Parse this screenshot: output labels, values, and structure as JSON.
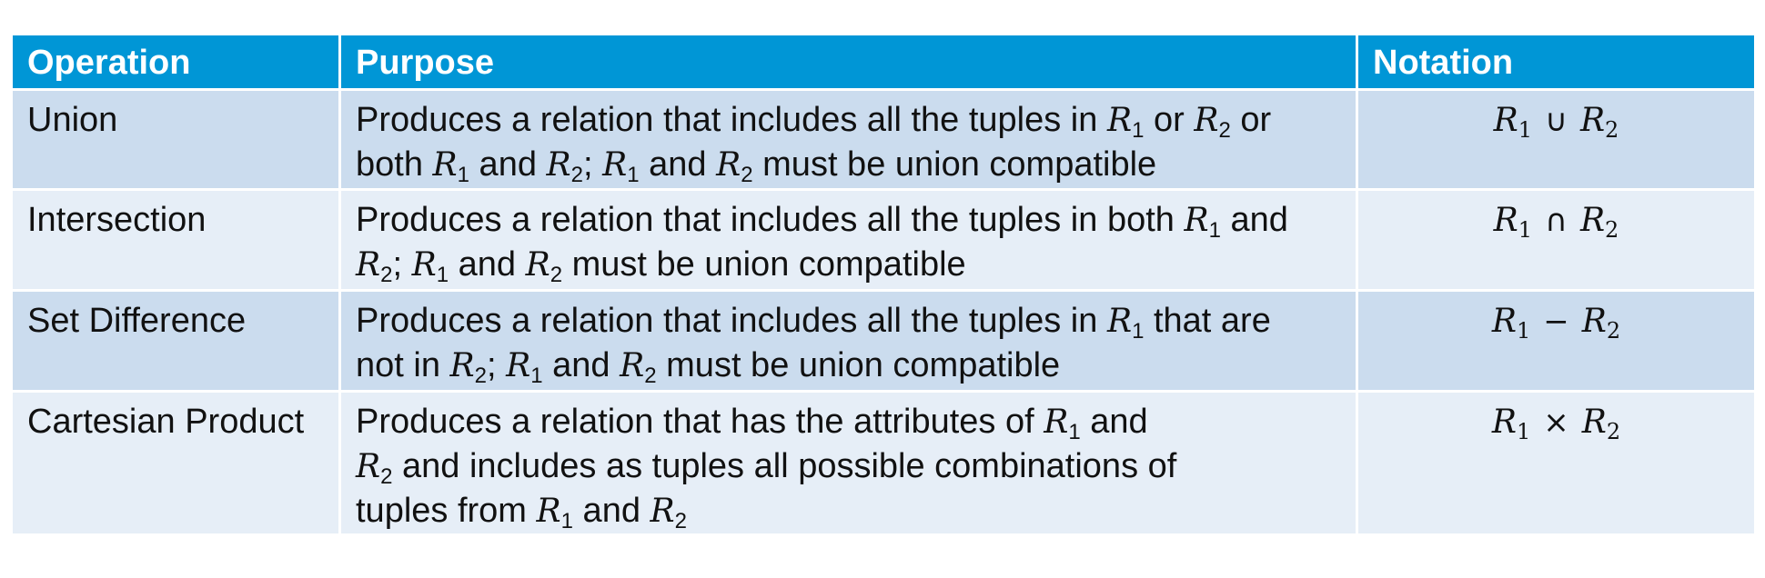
{
  "table": {
    "headers": {
      "operation": "Operation",
      "purpose": "Purpose",
      "notation": "Notation"
    },
    "rows": [
      {
        "operation": "Union",
        "purpose_lines": [
          [
            "Produces a relation that includes all the tuples in ",
            "R",
            "1",
            " or ",
            "R",
            "2",
            " or"
          ],
          [
            "both ",
            "R",
            "1",
            " and ",
            "R",
            "2",
            "; ",
            "R",
            "1",
            " and ",
            "R",
            "2",
            " must be union compatible"
          ]
        ],
        "notation": {
          "left": "R",
          "left_sub": "1",
          "symbol": "∪",
          "right": "R",
          "right_sub": "2"
        }
      },
      {
        "operation": "Intersection",
        "purpose_lines": [
          [
            "Produces a relation that includes all the tuples in both ",
            "R",
            "1",
            " and"
          ],
          [
            "",
            "R",
            "2",
            "; ",
            "R",
            "1",
            " and ",
            "R",
            "2",
            " must be union compatible"
          ]
        ],
        "notation": {
          "left": "R",
          "left_sub": "1",
          "symbol": "∩",
          "right": "R",
          "right_sub": "2"
        }
      },
      {
        "operation": "Set Difference",
        "purpose_lines": [
          [
            "Produces a relation that includes all the tuples in ",
            "R",
            "1",
            " that are"
          ],
          [
            "not in ",
            "R",
            "2",
            "; ",
            "R",
            "1",
            " and ",
            "R",
            "2",
            " must be union compatible"
          ]
        ],
        "notation": {
          "left": "R",
          "left_sub": "1",
          "symbol": "−",
          "right": "R",
          "right_sub": "2"
        }
      },
      {
        "operation": "Cartesian Product",
        "purpose_lines": [
          [
            "Produces a relation that has the attributes of ",
            "R",
            "1",
            " and"
          ],
          [
            "",
            "R",
            "2",
            " and includes as tuples all possible combinations of"
          ],
          [
            "tuples from ",
            "R",
            "1",
            " and ",
            "R",
            "2",
            ""
          ]
        ],
        "notation": {
          "left": "R",
          "left_sub": "1",
          "symbol": "×",
          "right": "R",
          "right_sub": "2"
        }
      }
    ]
  }
}
